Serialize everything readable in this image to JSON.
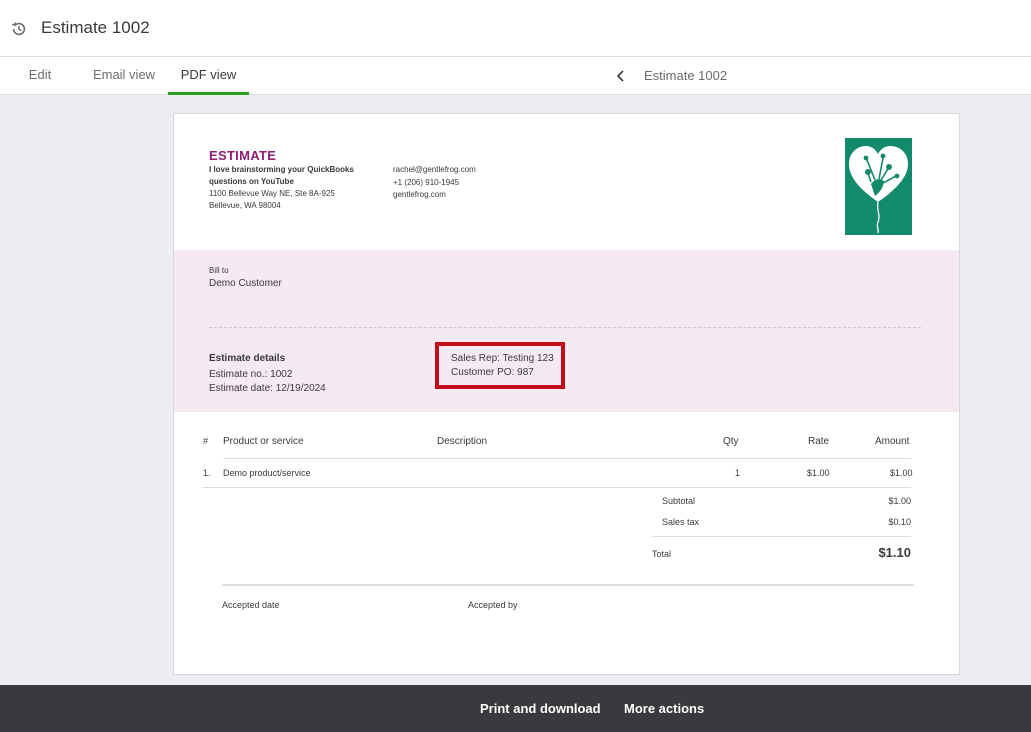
{
  "header": {
    "title": "Estimate 1002",
    "icon": "history-icon"
  },
  "tabs": [
    {
      "label": "Edit",
      "active": false
    },
    {
      "label": "Email view",
      "active": false
    },
    {
      "label": "PDF view",
      "active": true
    }
  ],
  "nav": {
    "title": "Estimate 1002"
  },
  "colors": {
    "accent": "#2ca01c",
    "brand": "#8d1f74",
    "band": "#f6e9f1",
    "logo": "#148a6c",
    "highlight": "#c40c1e",
    "footer": "#393a3d"
  },
  "document": {
    "heading": "ESTIMATE",
    "company": {
      "name_line1": "I love brainstorming your QuickBooks",
      "name_line2": "questions on YouTube",
      "address1": "1100 Bellevue Way NE, Ste 8A-925",
      "address2": "Bellevue, WA 98004"
    },
    "contact": {
      "email": "rachel@gentlefrog.com",
      "phone": "+1 (206) 910-1945",
      "website": "gentlefrog.com"
    },
    "bill_to": {
      "label": "Bill to",
      "name": "Demo Customer"
    },
    "details": {
      "title": "Estimate details",
      "number": "Estimate no.: 1002",
      "date": "Estimate date: 12/19/2024"
    },
    "custom_fields": {
      "sales_rep": "Sales Rep: Testing 123",
      "customer_po": "Customer PO: 987"
    },
    "table": {
      "headers": {
        "num": "#",
        "product": "Product or service",
        "description": "Description",
        "qty": "Qty",
        "rate": "Rate",
        "amount": "Amount"
      },
      "rows": [
        {
          "num": "1.",
          "product": "Demo product/service",
          "description": "",
          "qty": "1",
          "rate": "$1.00",
          "amount": "$1.00"
        }
      ]
    },
    "totals": {
      "subtotal_label": "Subtotal",
      "subtotal": "$1.00",
      "tax_label": "Sales tax",
      "tax": "$0.10",
      "total_label": "Total",
      "total": "$1.10"
    },
    "acceptance": {
      "date_label": "Accepted date",
      "by_label": "Accepted by"
    }
  },
  "footer": {
    "print_label": "Print and download",
    "more_label": "More actions"
  }
}
